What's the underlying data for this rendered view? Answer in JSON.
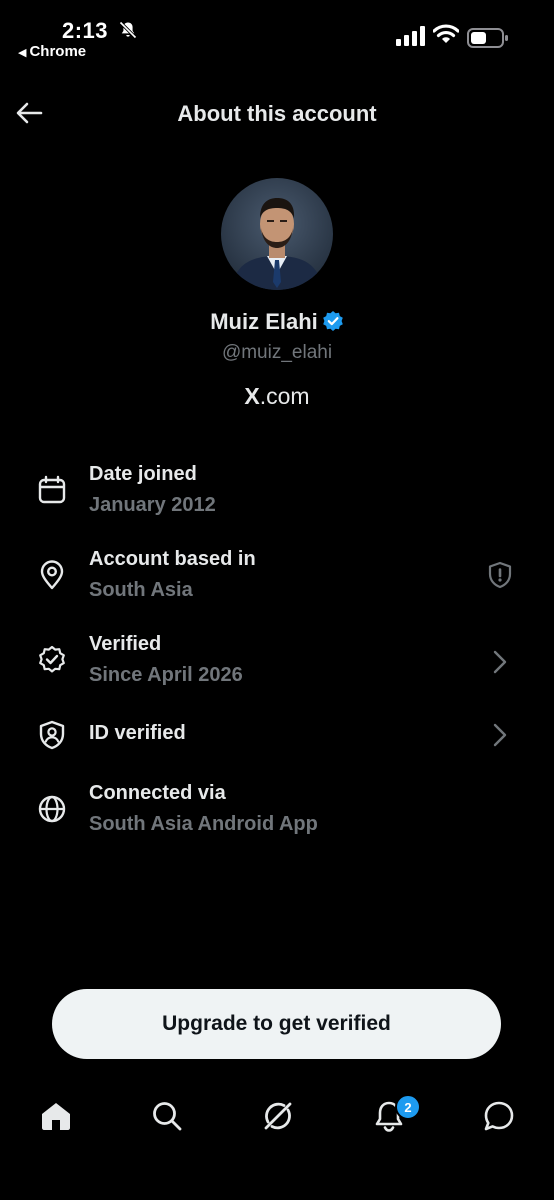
{
  "status_bar": {
    "time": "2:13",
    "back_app": "Chrome"
  },
  "header": {
    "title": "About this account"
  },
  "profile": {
    "name": "Muiz Elahi",
    "handle": "@muiz_elahi",
    "site_prefix": "X",
    "site_suffix": ".com"
  },
  "rows": [
    {
      "label": "Date joined",
      "value": "January 2012",
      "icon": "calendar-icon"
    },
    {
      "label": "Account based in",
      "value": "South Asia",
      "icon": "location-pin-icon",
      "trailing": "shield-alert-icon"
    },
    {
      "label": "Verified",
      "value": "Since April 2026",
      "icon": "verified-badge-outline-icon",
      "trailing": "chevron-right-icon"
    },
    {
      "label": "ID verified",
      "value": "",
      "icon": "id-shield-icon",
      "trailing": "chevron-right-icon"
    },
    {
      "label": "Connected via",
      "value": "South Asia Android App",
      "icon": "globe-icon"
    }
  ],
  "cta": {
    "label": "Upgrade to get verified"
  },
  "bottom_nav": {
    "items": [
      "home-icon",
      "search-icon",
      "grok-icon",
      "notifications-icon",
      "messages-icon"
    ],
    "notification_count": "2"
  },
  "colors": {
    "background": "#000000",
    "primary_text": "#e7e9ea",
    "secondary_text": "#71767b",
    "accent": "#1d9bf0",
    "button_bg": "#eff3f4"
  }
}
